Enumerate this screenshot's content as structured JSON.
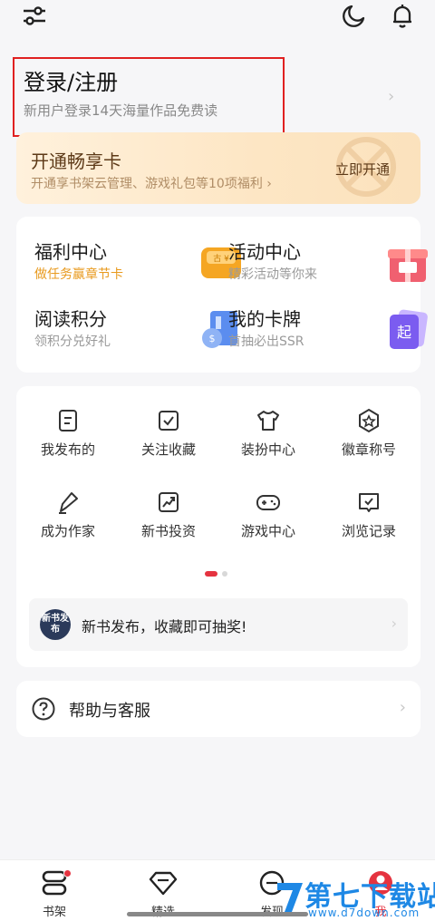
{
  "login": {
    "title": "登录/注册",
    "subtitle": "新用户登录14天海量作品免费读"
  },
  "vip": {
    "title": "开通畅享卡",
    "subtitle": "开通享书架云管理、游戏礼包等10项福利 ›",
    "button": "立即开通"
  },
  "benefits": [
    {
      "title": "福利中心",
      "subtitle": "做任务赢章节卡",
      "icon": "coin-wallet-icon"
    },
    {
      "title": "活动中心",
      "subtitle": "精彩活动等你来",
      "icon": "gift-box-icon"
    },
    {
      "title": "阅读积分",
      "subtitle": "领积分兑好礼",
      "icon": "book-coin-icon"
    },
    {
      "title": "我的卡牌",
      "subtitle": "首抽必出SSR",
      "icon": "card-qi-icon"
    }
  ],
  "grid": [
    {
      "label": "我发布的",
      "icon": "document-icon"
    },
    {
      "label": "关注收藏",
      "icon": "bookmark-check-icon"
    },
    {
      "label": "装扮中心",
      "icon": "tshirt-icon"
    },
    {
      "label": "徽章称号",
      "icon": "badge-star-icon"
    },
    {
      "label": "成为作家",
      "icon": "pen-icon"
    },
    {
      "label": "新书投资",
      "icon": "trend-chart-icon"
    },
    {
      "label": "游戏中心",
      "icon": "gamepad-icon"
    },
    {
      "label": "浏览记录",
      "icon": "history-icon"
    }
  ],
  "promo": {
    "badge": "新书发布",
    "text": "新书发布，收藏即可抽奖!"
  },
  "help": {
    "label": "帮助与客服"
  },
  "tabs": [
    {
      "label": "书架",
      "icon": "bookshelf-icon"
    },
    {
      "label": "精选",
      "icon": "diamond-icon"
    },
    {
      "label": "发现",
      "icon": "discover-icon"
    },
    {
      "label": "我",
      "icon": "profile-icon"
    }
  ],
  "watermark": {
    "title": "第七下载站",
    "url": "www.d7down.com"
  },
  "colors": {
    "accent": "#e53340",
    "vip_text": "#5d3a18",
    "orange": "#e89a1e"
  }
}
